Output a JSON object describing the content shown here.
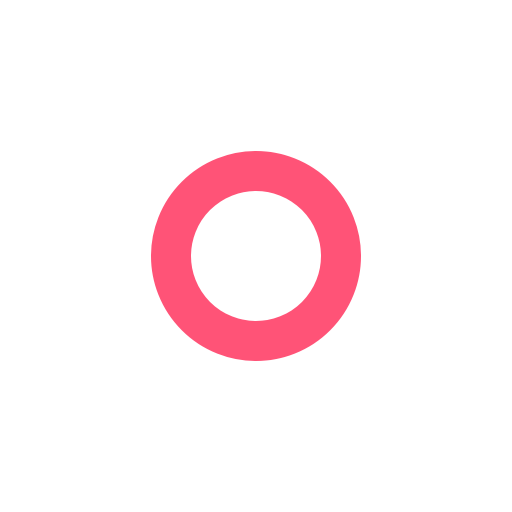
{
  "icon": {
    "name": "ring-icon",
    "color": "#ff5377",
    "background": "#ffffff"
  }
}
